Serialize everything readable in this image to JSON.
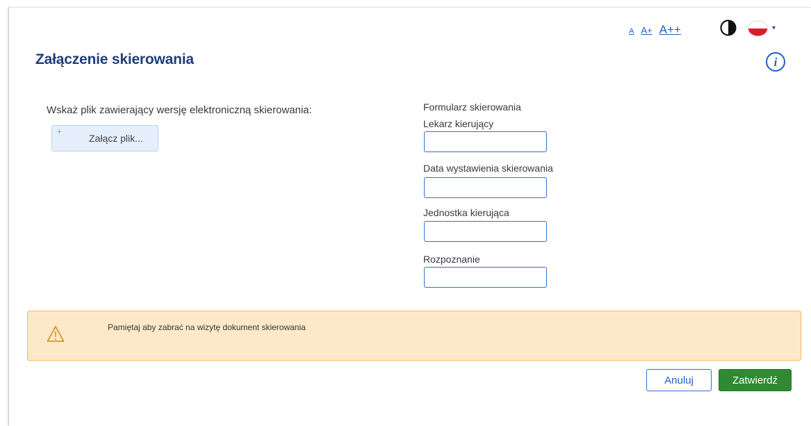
{
  "accessibility": {
    "font_small": "A",
    "font_medium": "A+",
    "font_large": "A++",
    "contrast_icon": "contrast-icon",
    "language_icon": "flag-pl-icon",
    "language_caret": "▾"
  },
  "header": {
    "title": "Załączenie skierowania",
    "info_icon": "info-icon",
    "info_glyph": "i"
  },
  "attachment": {
    "prompt": "Wskaż plik zawierający wersję elektroniczną skierowania:",
    "button_label": "Załącz plik...",
    "button_icon": "+"
  },
  "form": {
    "title": "Formularz skierowania",
    "fields": [
      {
        "label": "Lekarz kierujący",
        "value": ""
      },
      {
        "label": "Data wystawienia skierowania",
        "value": ""
      },
      {
        "label": "Jednostka kierująca",
        "value": ""
      },
      {
        "label": "Rozpoznanie",
        "value": ""
      }
    ]
  },
  "warning": {
    "text": "Pamiętaj aby zabrać na wizytę dokument skierowania",
    "icon": "warning-icon"
  },
  "actions": {
    "cancel_label": "Anuluj",
    "submit_label": "Zatwierdź"
  },
  "colors": {
    "title": "#1f3f78",
    "link": "#1f5fbf",
    "input_border": "#2f6fc9",
    "warning_bg": "#fde9c8",
    "warning_border": "#f0b85b",
    "submit_bg": "#2f8a33"
  }
}
